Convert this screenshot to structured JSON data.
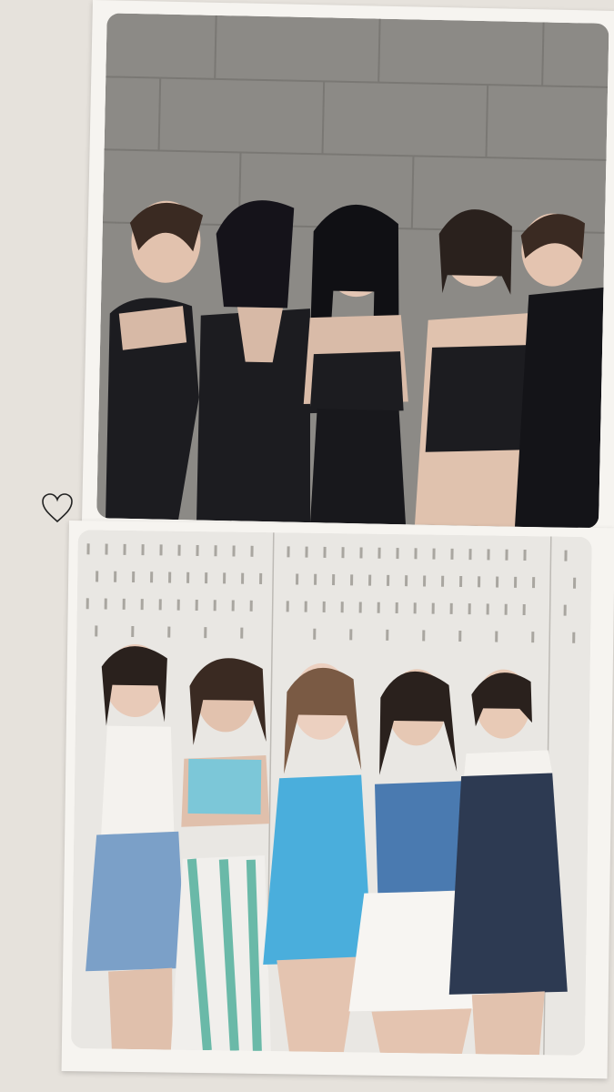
{
  "colors": {
    "background": "#e6e2dc",
    "card": "#f6f4f0",
    "wall_top": "#8c8a86",
    "wall_bottom": "#e9e7e3",
    "outfit_black": "#1c1c20",
    "denim_blue": "#4a7ab0",
    "sky_blue": "#4aaedc",
    "skin": "#e2c2ae",
    "hair": "#2a211d"
  },
  "icons": {
    "heart": "heart-outline-icon"
  },
  "photos": [
    {
      "scene": "five-members-black-outfits-gray-wall"
    },
    {
      "scene": "five-members-summer-outfits-white-perforated-wall"
    }
  ]
}
